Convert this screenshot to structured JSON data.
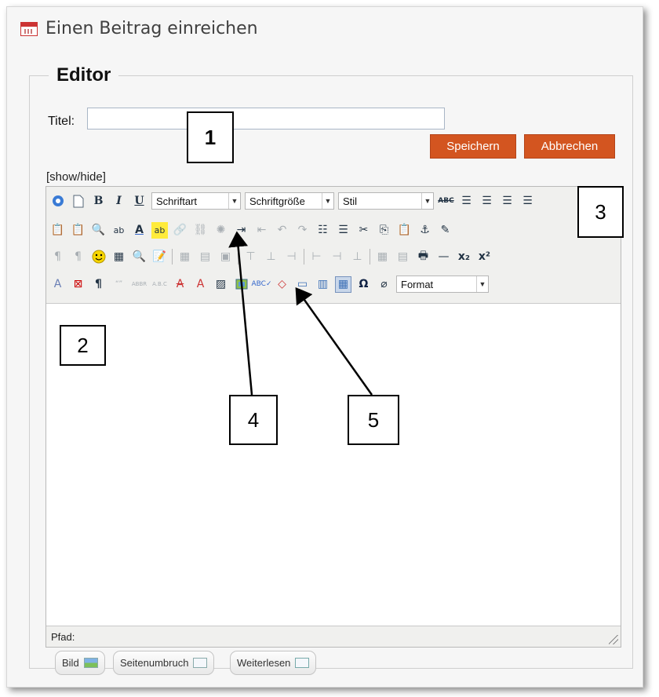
{
  "page": {
    "title": "Einen Beitrag einreichen"
  },
  "editor_fieldset": {
    "legend": "Editor"
  },
  "form": {
    "titel_label": "Titel:",
    "titel_value": "",
    "save_label": "Speichern",
    "cancel_label": "Abbrechen",
    "show_hide": "[show/hide]"
  },
  "toolbar": {
    "font_family": "Schriftart",
    "font_size": "Schriftgröße",
    "style": "Stil",
    "format": "Format"
  },
  "status": {
    "path_label": "Pfad:"
  },
  "bottom_buttons": {
    "image": "Bild",
    "pagebreak": "Seitenumbruch",
    "readmore": "Weiterlesen"
  },
  "callouts": {
    "c1": "1",
    "c2": "2",
    "c3": "3",
    "c4": "4",
    "c5": "5"
  },
  "colors": {
    "accent": "#d35520",
    "panel": "#f6f6f6",
    "toolbar": "#f0f0ee"
  }
}
